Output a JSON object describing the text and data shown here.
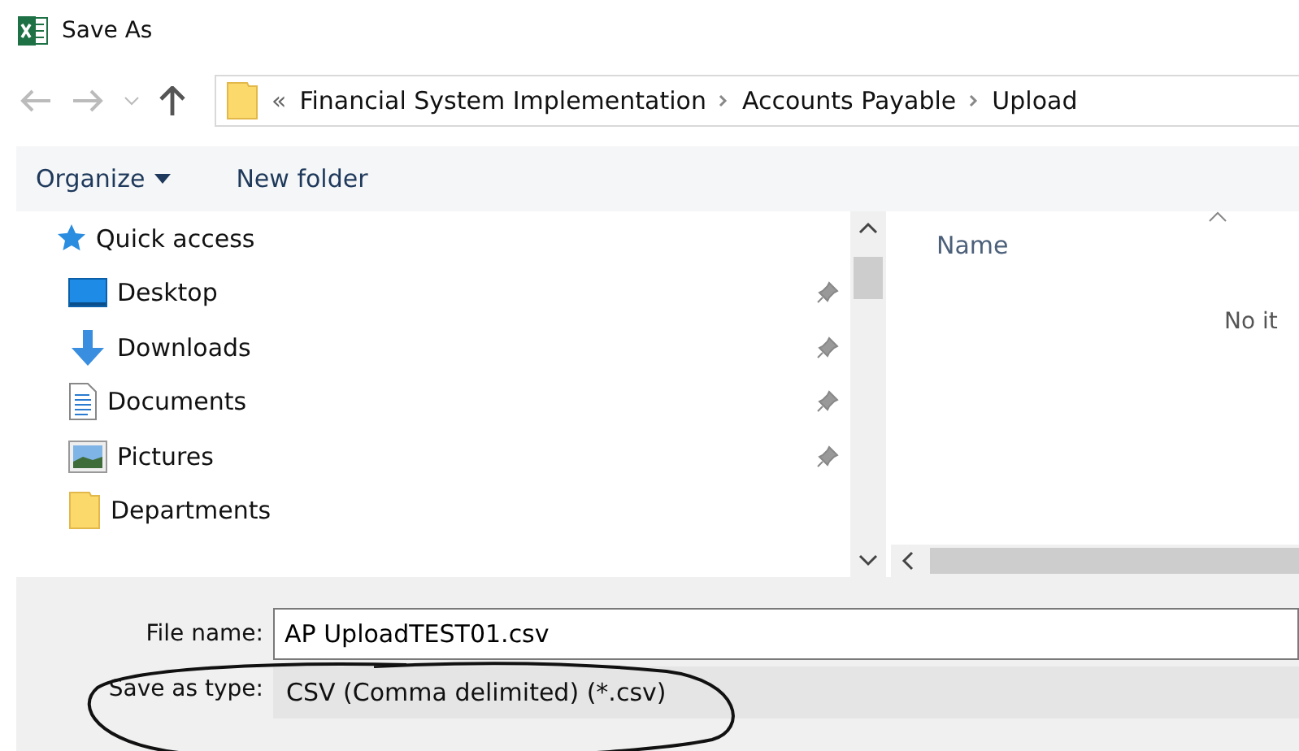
{
  "window": {
    "title": "Save As"
  },
  "address": {
    "prefix": "«",
    "crumbs": [
      "Financial System Implementation",
      "Accounts Payable",
      "Upload"
    ]
  },
  "toolbar": {
    "organize": "Organize",
    "new_folder": "New folder"
  },
  "nav": [
    {
      "label": "Quick access",
      "kind": "star",
      "pinned": false
    },
    {
      "label": "Desktop",
      "kind": "desktop",
      "pinned": true
    },
    {
      "label": "Downloads",
      "kind": "download",
      "pinned": true
    },
    {
      "label": "Documents",
      "kind": "document",
      "pinned": true
    },
    {
      "label": "Pictures",
      "kind": "pictures",
      "pinned": true
    },
    {
      "label": "Departments",
      "kind": "folder",
      "pinned": false
    }
  ],
  "list": {
    "column": "Name",
    "empty": "No it"
  },
  "form": {
    "file_name_label": "File name:",
    "file_name": "AP UploadTEST01.csv",
    "type_label": "Save as type:",
    "type": "CSV (Comma delimited) (*.csv)"
  }
}
